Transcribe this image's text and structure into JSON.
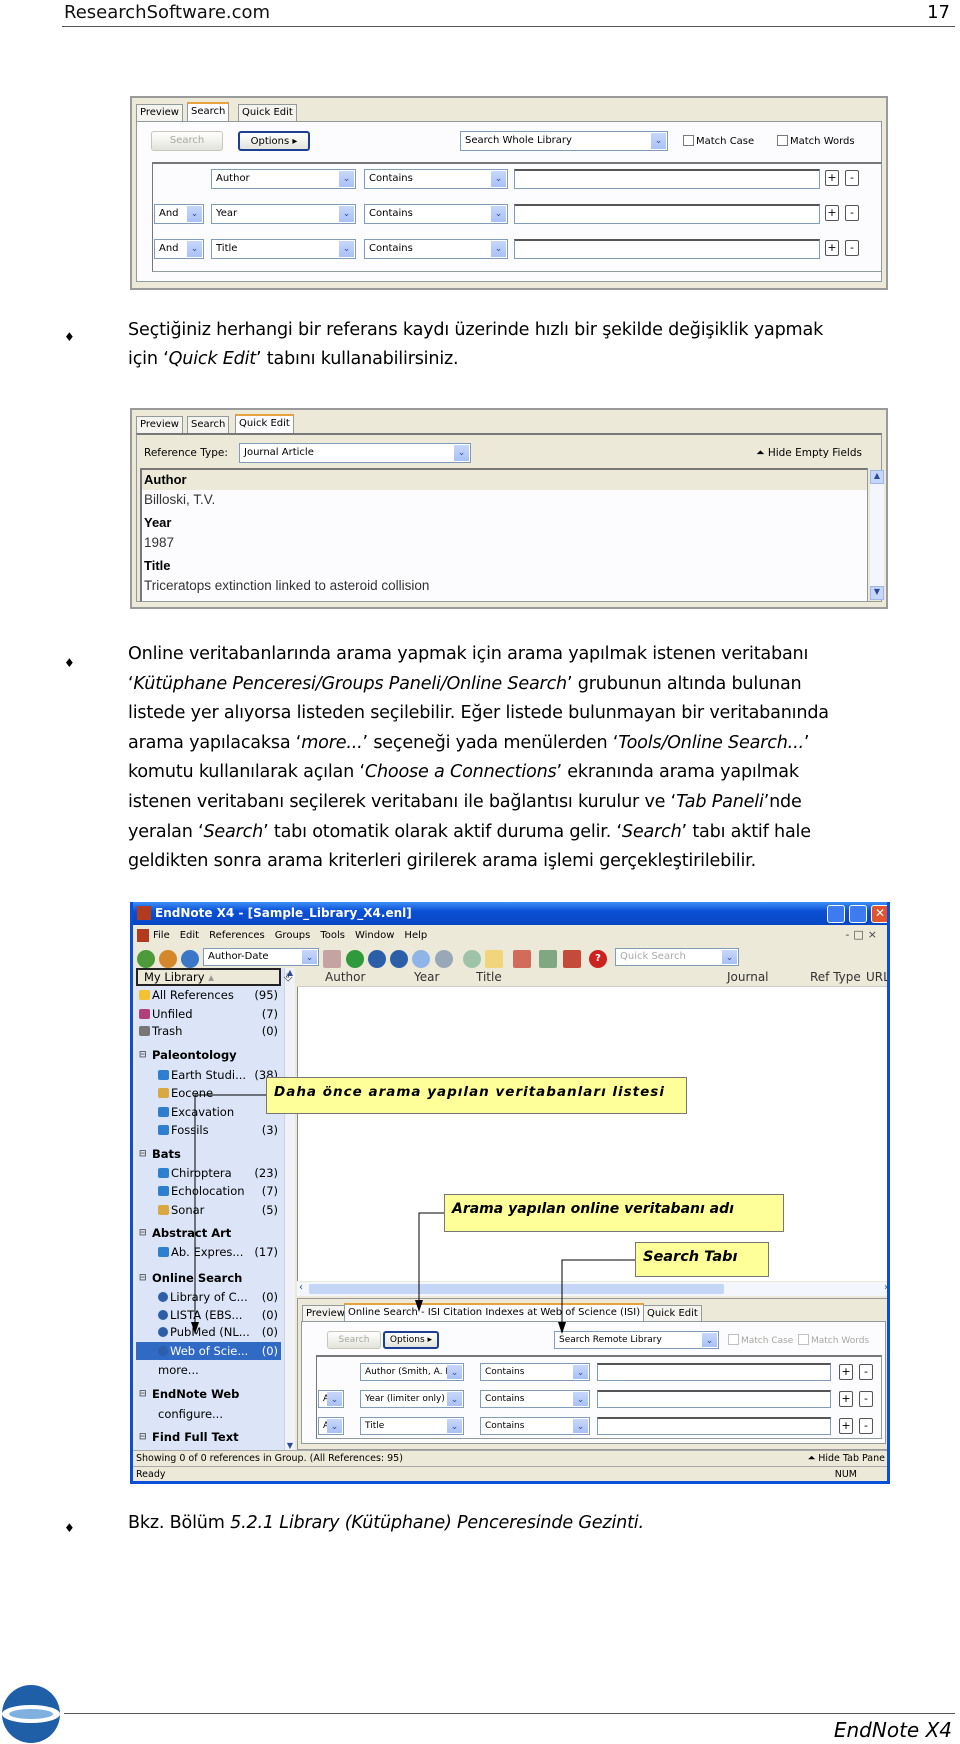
{
  "header": {
    "site": "ResearchSoftware.com",
    "page_number": "17"
  },
  "shot1": {
    "tabs": [
      "Preview",
      "Search",
      "Quick Edit"
    ],
    "active_tab": "Search",
    "search_button": "Search",
    "options_button": "Options",
    "scope_select": "Search Whole Library",
    "match_case": "Match Case",
    "match_words": "Match Words",
    "rows": [
      {
        "bool": "",
        "field": "Author",
        "op": "Contains",
        "value": ""
      },
      {
        "bool": "And",
        "field": "Year",
        "op": "Contains",
        "value": ""
      },
      {
        "bool": "And",
        "field": "Title",
        "op": "Contains",
        "value": ""
      }
    ]
  },
  "bullet1": {
    "lines": [
      [
        {
          "t": "Seçtiğiniz herhangi bir referans kaydı üzerinde hızlı bir şekilde değişiklik yapmak",
          "i": false
        }
      ],
      [
        {
          "t": "için ‘",
          "i": false
        },
        {
          "t": "Quick Edit",
          "i": true
        },
        {
          "t": "’ tabını kullanabilirsiniz.",
          "i": false
        }
      ]
    ]
  },
  "shot2": {
    "tabs": [
      "Preview",
      "Search",
      "Quick Edit"
    ],
    "active_tab": "Quick Edit",
    "ref_type_label": "Reference Type:",
    "ref_type_value": "Journal Article",
    "hide_empty": "Hide Empty Fields",
    "fields": [
      {
        "label": "Author",
        "value": "Billoski, T.V."
      },
      {
        "label": "Year",
        "value": "1987"
      },
      {
        "label": "Title",
        "value": "Triceratops extinction linked to asteroid collision"
      }
    ]
  },
  "bullet2": {
    "lines": [
      [
        {
          "t": "Online veritabanlarında arama yapmak için arama yapılmak istenen veritabanı",
          "i": false
        }
      ],
      [
        {
          "t": "‘",
          "i": false
        },
        {
          "t": "Kütüphane Penceresi/Groups Paneli/Online Search",
          "i": true
        },
        {
          "t": "’ grubunun altında bulunan",
          "i": false
        }
      ],
      [
        {
          "t": "listede yer alıyorsa listeden seçilebilir. Eğer listede bulunmayan bir veritabanında",
          "i": false
        }
      ],
      [
        {
          "t": "arama yapılacaksa ‘",
          "i": false
        },
        {
          "t": "more...",
          "i": true
        },
        {
          "t": "’ seçeneği yada menülerden ‘",
          "i": false
        },
        {
          "t": "Tools/Online Search...",
          "i": true
        },
        {
          "t": "’",
          "i": false
        }
      ],
      [
        {
          "t": "komutu kullanılarak açılan ‘",
          "i": false
        },
        {
          "t": "Choose a Connections",
          "i": true
        },
        {
          "t": "’ ekranında arama yapılmak",
          "i": false
        }
      ],
      [
        {
          "t": "istenen veritabanı seçilerek veritabanı ile bağlantısı kurulur ve ‘",
          "i": false
        },
        {
          "t": "Tab Paneli",
          "i": true
        },
        {
          "t": "’nde",
          "i": false
        }
      ],
      [
        {
          "t": "yeralan ‘",
          "i": false
        },
        {
          "t": "Search",
          "i": true
        },
        {
          "t": "’ tabı otomatik olarak aktif duruma gelir. ‘",
          "i": false
        },
        {
          "t": "Search",
          "i": true
        },
        {
          "t": "’ tabı aktif hale",
          "i": false
        }
      ],
      [
        {
          "t": "geldikten sonra arama kriterleri girilerek arama işlemi gerçekleştirilebilir.",
          "i": false
        }
      ]
    ]
  },
  "shot3": {
    "title": "EndNote X4 - [Sample_Library_X4.enl]",
    "menu": [
      "File",
      "Edit",
      "References",
      "Groups",
      "Tools",
      "Window",
      "Help"
    ],
    "style_select": "Author-Date",
    "quick_search_placeholder": "Quick Search",
    "library_header": "My Library",
    "columns": [
      "Author",
      "Year",
      "Title",
      "Journal",
      "Ref Type",
      "URL"
    ],
    "groups": [
      {
        "label": "All References",
        "count": "(95)",
        "kind": "item",
        "icon": "all-references-icon"
      },
      {
        "label": "Unfiled",
        "count": "(7)",
        "kind": "item",
        "icon": "unfiled-icon"
      },
      {
        "label": "Trash",
        "count": "(0)",
        "kind": "item",
        "icon": "trash-icon"
      },
      {
        "label": "Paleontology",
        "count": "",
        "kind": "header"
      },
      {
        "label": "Earth Studi...",
        "count": "(38)",
        "kind": "sub",
        "icon": "folder-icon"
      },
      {
        "label": "Eocene",
        "count": "",
        "kind": "sub",
        "icon": "smart-group-icon"
      },
      {
        "label": "Excavation",
        "count": "",
        "kind": "sub",
        "icon": "folder-icon"
      },
      {
        "label": "Fossils",
        "count": "(3)",
        "kind": "sub",
        "icon": "folder-icon"
      },
      {
        "label": "Bats",
        "count": "",
        "kind": "header"
      },
      {
        "label": "Chiroptera",
        "count": "(23)",
        "kind": "sub",
        "icon": "folder-icon"
      },
      {
        "label": "Echolocation",
        "count": "(7)",
        "kind": "sub",
        "icon": "folder-icon"
      },
      {
        "label": "Sonar",
        "count": "(5)",
        "kind": "sub",
        "icon": "smart-group-icon"
      },
      {
        "label": "Abstract Art",
        "count": "",
        "kind": "header"
      },
      {
        "label": "Ab. Expres...",
        "count": "(17)",
        "kind": "sub",
        "icon": "folder-icon"
      },
      {
        "label": "Online Search",
        "count": "",
        "kind": "header"
      },
      {
        "label": "Library of C...",
        "count": "(0)",
        "kind": "sub",
        "icon": "online-search-icon"
      },
      {
        "label": "LISTA (EBS...",
        "count": "(0)",
        "kind": "sub",
        "icon": "online-search-icon"
      },
      {
        "label": "PubMed (NL...",
        "count": "(0)",
        "kind": "sub",
        "icon": "online-search-icon"
      },
      {
        "label": "Web of Scie...",
        "count": "(0)",
        "kind": "selected",
        "icon": "online-search-icon"
      },
      {
        "label": "more...",
        "count": "",
        "kind": "plain"
      },
      {
        "label": "EndNote Web",
        "count": "",
        "kind": "header"
      },
      {
        "label": "configure...",
        "count": "",
        "kind": "plain"
      },
      {
        "label": "Find Full Text",
        "count": "",
        "kind": "header"
      }
    ],
    "tabs": [
      "Preview",
      "Online Search - ISI Citation Indexes at Web of Science (ISI)",
      "Quick Edit"
    ],
    "search_button": "Search",
    "options_button": "Options",
    "scope_select": "Search Remote Library",
    "match_case": "Match Case",
    "match_words": "Match Words",
    "rows": [
      {
        "bool": "",
        "field": "Author (Smith, A. B.)",
        "op": "Contains",
        "value": ""
      },
      {
        "bool": "And",
        "field": "Year (limiter only)",
        "op": "Contains",
        "value": ""
      },
      {
        "bool": "And",
        "field": "Title",
        "op": "Contains",
        "value": ""
      }
    ],
    "status": "Showing 0 of 0 references in Group. (All References: 95)",
    "hide_tab_pane": "Hide Tab Pane",
    "ready": "Ready",
    "num": "NUM",
    "callouts": {
      "databases": "Daha önce arama yapılan veritabanları listesi",
      "online_db": "Arama yapılan online veritabanı adı",
      "search_tab": "Search Tabı"
    },
    "colors": {
      "titlebar": "#0a4fd6",
      "selection": "#316ac5",
      "callout": "#ffff99",
      "groups_bg": "#dbe5f7"
    }
  },
  "bullet3": {
    "lines": [
      [
        {
          "t": "Bkz. Bölüm ",
          "i": false
        },
        {
          "t": "5.2.1 Library (Kütüphane) Penceresinde Gezinti.",
          "i": true
        }
      ]
    ]
  },
  "footer": {
    "product": "EndNote X4"
  }
}
